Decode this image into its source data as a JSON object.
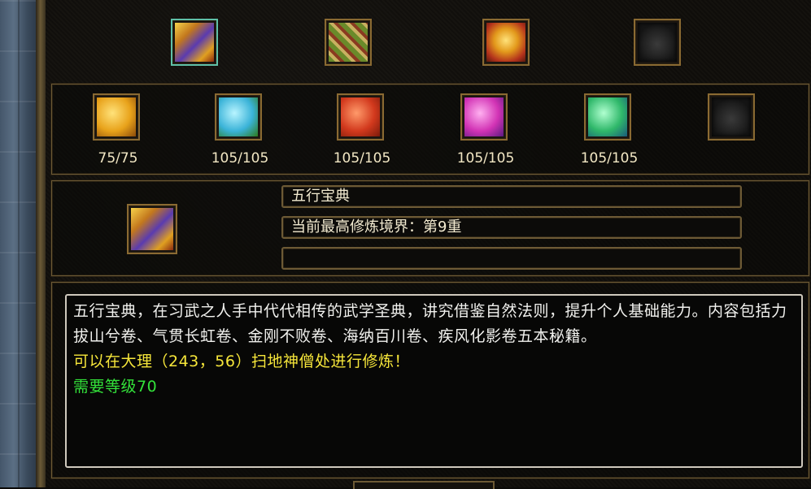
{
  "top_items": [
    {
      "name": "book-gold-icon",
      "selected": true
    },
    {
      "name": "scroll-bundle-icon",
      "selected": false
    },
    {
      "name": "gold-bundle-icon",
      "selected": false
    },
    {
      "name": "empty-slot-icon",
      "selected": false
    }
  ],
  "books": [
    {
      "name": "book-yellow-icon",
      "count": "75/75",
      "color": "#e8a21a"
    },
    {
      "name": "book-cyan-icon",
      "count": "105/105",
      "color": "#3ab3d8"
    },
    {
      "name": "book-red-icon",
      "count": "105/105",
      "color": "#d2391d"
    },
    {
      "name": "book-magenta-icon",
      "count": "105/105",
      "color": "#d233b5"
    },
    {
      "name": "book-green-icon",
      "count": "105/105",
      "color": "#2fb86a"
    },
    {
      "name": "empty-slot-icon",
      "count": "",
      "color": "#222222"
    }
  ],
  "detail": {
    "title": "五行宝典",
    "realm": "当前最高修炼境界：第9重",
    "extra": ""
  },
  "description": {
    "line1": "五行宝典，在习武之人手中代代相传的武学圣典，讲究借鉴自然法则，提升个人基础能力。内容包括力拔山兮卷、气贯长虹卷、金刚不败卷、海纳百川卷、疾风化影卷五本秘籍。",
    "location": "可以在大理（243，56）扫地神僧处进行修炼！",
    "requirement": "需要等级70"
  },
  "colors": {
    "accent": "#6d5a35",
    "yellow_text": "#f6e63a",
    "green_text": "#33e23a"
  }
}
